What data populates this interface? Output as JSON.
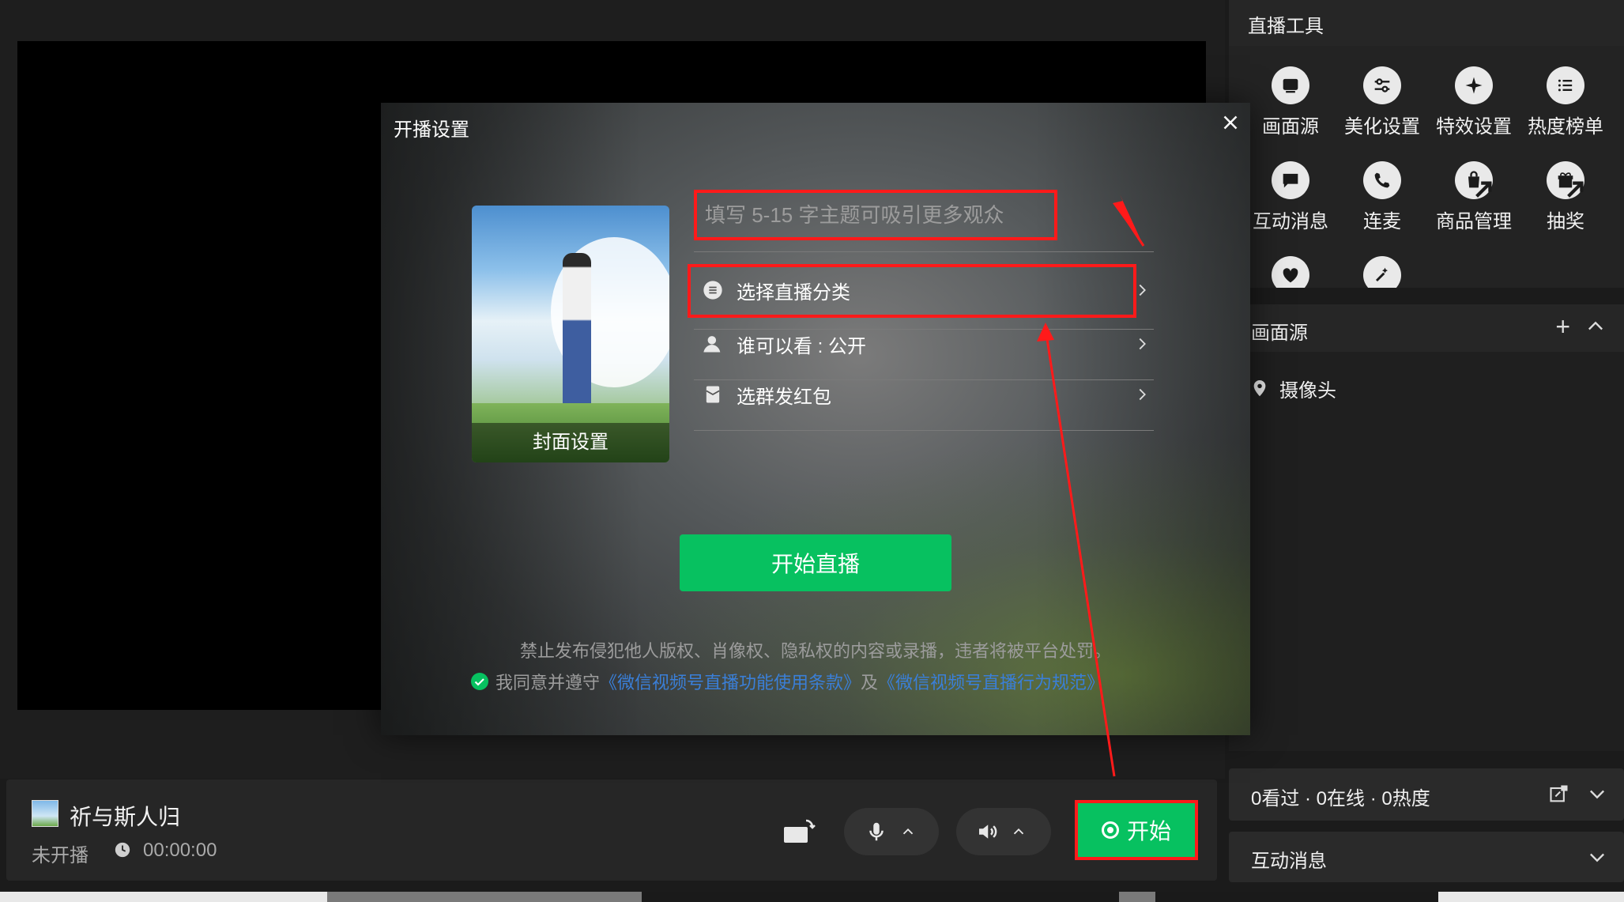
{
  "tools_panel": {
    "title": "直播工具",
    "items": [
      {
        "label": "画面源",
        "icon": "screen-source-icon"
      },
      {
        "label": "美化设置",
        "icon": "sliders-icon"
      },
      {
        "label": "特效设置",
        "icon": "sparkle-icon"
      },
      {
        "label": "热度榜单",
        "icon": "list-icon"
      },
      {
        "label": "互动消息",
        "icon": "chat-icon"
      },
      {
        "label": "连麦",
        "icon": "phone-icon"
      },
      {
        "label": "商品管理",
        "icon": "shopping-bag-icon"
      },
      {
        "label": "抽奖",
        "icon": "gift-icon"
      }
    ]
  },
  "sources": {
    "title": "画面源",
    "items": [
      {
        "label": "摄像头"
      }
    ]
  },
  "stats": {
    "text": "0看过 · 0在线 · 0热度"
  },
  "interactive_messages": {
    "title": "互动消息"
  },
  "room": {
    "name": "祈与斯人归",
    "status": "未开播",
    "timer": "00:00:00"
  },
  "controls": {
    "start_label": "开始"
  },
  "modal": {
    "title": "开播设置",
    "cover_caption": "封面设置",
    "title_placeholder": "填写 5-15 字主题可吸引更多观众",
    "rows": [
      {
        "label": "选择直播分类"
      },
      {
        "label": "谁可以看 : 公开"
      },
      {
        "label": "选群发红包"
      }
    ],
    "go_live_label": "开始直播",
    "notice": "禁止发布侵犯他人版权、肖像权、隐私权的内容或录播，违者将被平台处罚。",
    "agree_prefix": "我同意并遵守",
    "agree_link1": "《微信视频号直播功能使用条款》",
    "agree_mid": "及",
    "agree_link2": "《微信视频号直播行为规范》"
  },
  "colors": {
    "accent": "#07c160",
    "annotation": "#ff1a1a",
    "link": "#3a7fd8"
  }
}
